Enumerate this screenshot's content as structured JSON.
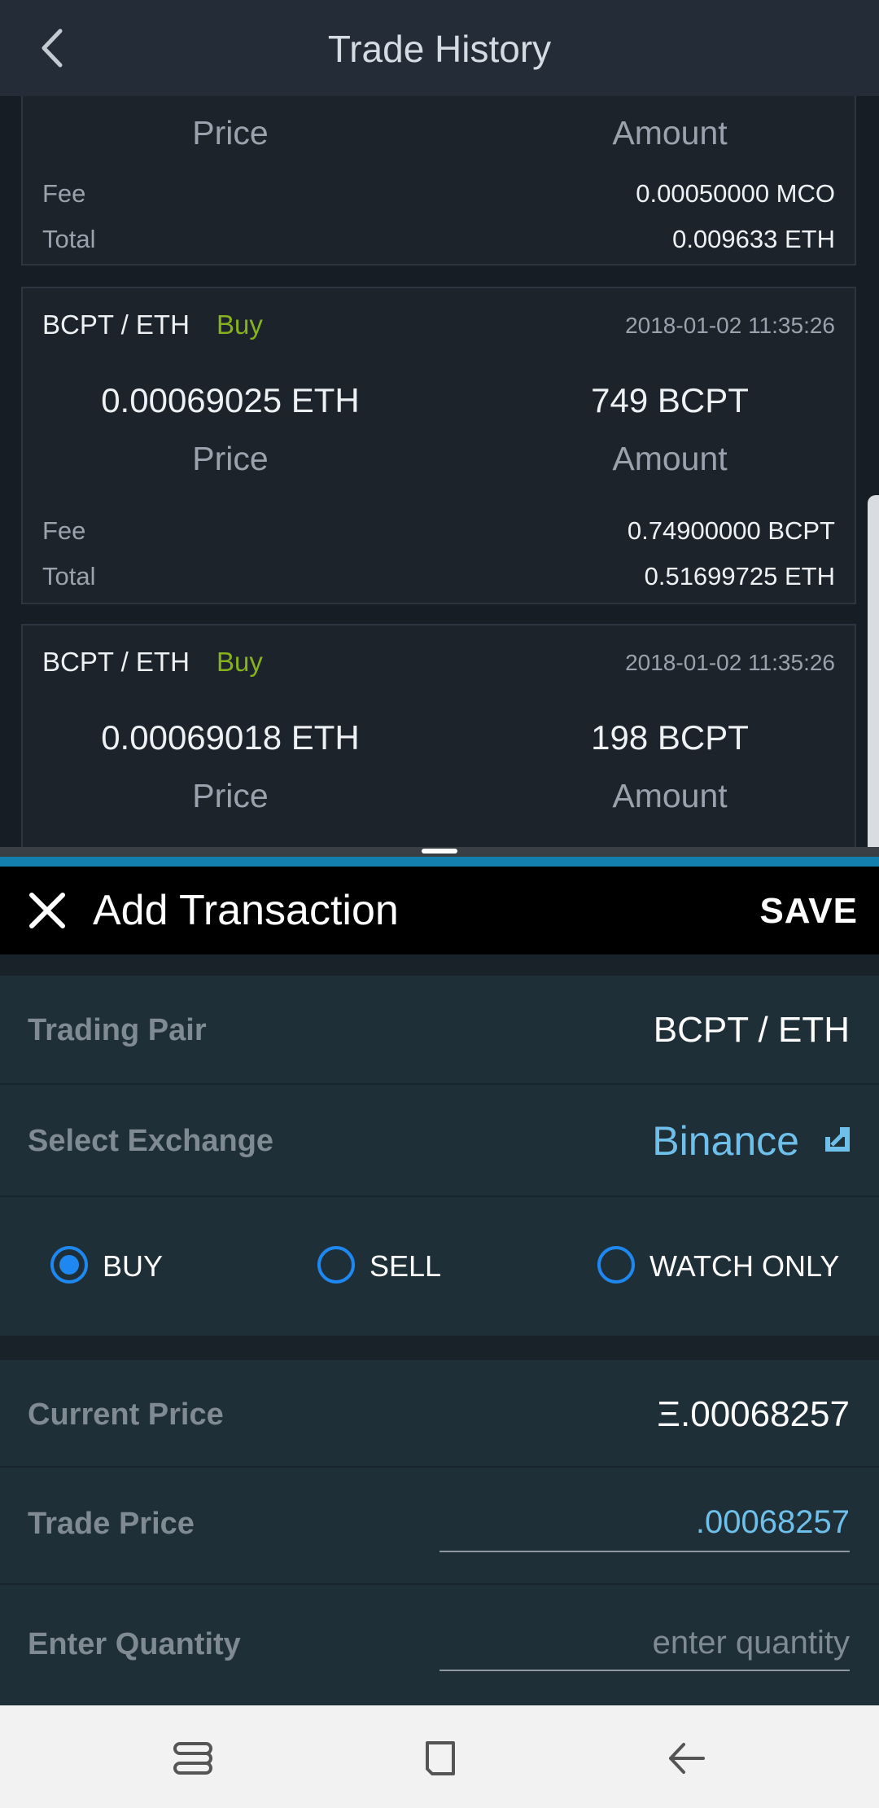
{
  "header": {
    "title": "Trade History"
  },
  "trades": [
    {
      "price": "",
      "amount": "",
      "price_label": "Price",
      "amount_label": "Amount",
      "fee_label": "Fee",
      "fee": "0.00050000 MCO",
      "total_label": "Total",
      "total": "0.009633 ETH"
    },
    {
      "pair": "BCPT / ETH",
      "side": "Buy",
      "date": "2018-01-02 11:35:26",
      "price": "0.00069025 ETH",
      "amount": "749 BCPT",
      "price_label": "Price",
      "amount_label": "Amount",
      "fee_label": "Fee",
      "fee": "0.74900000 BCPT",
      "total_label": "Total",
      "total": "0.51699725 ETH"
    },
    {
      "pair": "BCPT / ETH",
      "side": "Buy",
      "date": "2018-01-02 11:35:26",
      "price": "0.00069018 ETH",
      "amount": "198 BCPT",
      "price_label": "Price",
      "amount_label": "Amount"
    }
  ],
  "sheet": {
    "title": "Add Transaction",
    "save_label": "SAVE",
    "trading_pair_label": "Trading Pair",
    "trading_pair_value": "BCPT / ETH",
    "exchange_label": "Select Exchange",
    "exchange_value": "Binance",
    "options": [
      {
        "label": "BUY",
        "checked": true
      },
      {
        "label": "SELL",
        "checked": false
      },
      {
        "label": "WATCH ONLY",
        "checked": false
      }
    ],
    "current_price_label": "Current Price",
    "current_price_value": "Ξ.00068257",
    "trade_price_label": "Trade Price",
    "trade_price_value": ".00068257",
    "quantity_label": "Enter Quantity",
    "quantity_placeholder": "enter quantity"
  },
  "colors": {
    "buy": "#86b21c",
    "accent_blue": "#6ec0ea",
    "radio": "#1e88f0",
    "divider": "#137fae"
  }
}
